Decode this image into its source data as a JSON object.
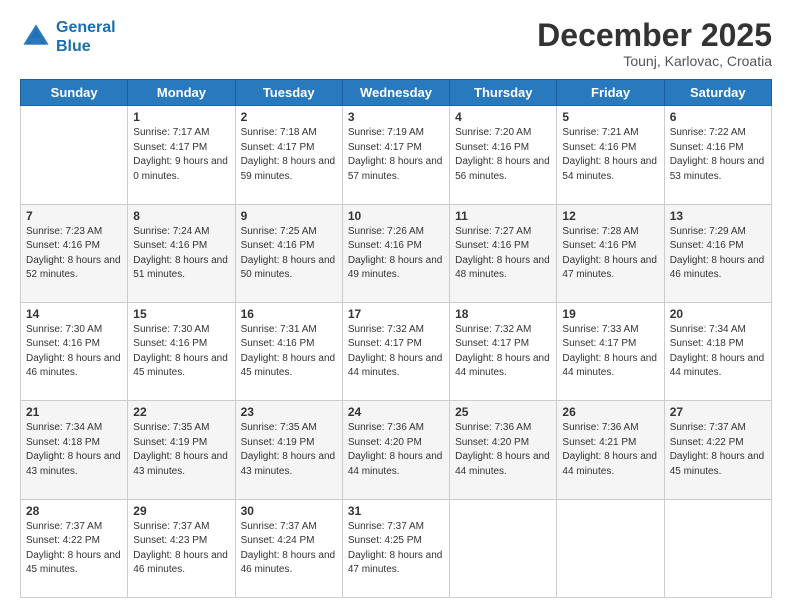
{
  "header": {
    "logo_line1": "General",
    "logo_line2": "Blue",
    "month": "December 2025",
    "location": "Tounj, Karlovac, Croatia"
  },
  "weekdays": [
    "Sunday",
    "Monday",
    "Tuesday",
    "Wednesday",
    "Thursday",
    "Friday",
    "Saturday"
  ],
  "weeks": [
    [
      {
        "day": "",
        "sunrise": "",
        "sunset": "",
        "daylight": ""
      },
      {
        "day": "1",
        "sunrise": "Sunrise: 7:17 AM",
        "sunset": "Sunset: 4:17 PM",
        "daylight": "Daylight: 9 hours and 0 minutes."
      },
      {
        "day": "2",
        "sunrise": "Sunrise: 7:18 AM",
        "sunset": "Sunset: 4:17 PM",
        "daylight": "Daylight: 8 hours and 59 minutes."
      },
      {
        "day": "3",
        "sunrise": "Sunrise: 7:19 AM",
        "sunset": "Sunset: 4:17 PM",
        "daylight": "Daylight: 8 hours and 57 minutes."
      },
      {
        "day": "4",
        "sunrise": "Sunrise: 7:20 AM",
        "sunset": "Sunset: 4:16 PM",
        "daylight": "Daylight: 8 hours and 56 minutes."
      },
      {
        "day": "5",
        "sunrise": "Sunrise: 7:21 AM",
        "sunset": "Sunset: 4:16 PM",
        "daylight": "Daylight: 8 hours and 54 minutes."
      },
      {
        "day": "6",
        "sunrise": "Sunrise: 7:22 AM",
        "sunset": "Sunset: 4:16 PM",
        "daylight": "Daylight: 8 hours and 53 minutes."
      }
    ],
    [
      {
        "day": "7",
        "sunrise": "Sunrise: 7:23 AM",
        "sunset": "Sunset: 4:16 PM",
        "daylight": "Daylight: 8 hours and 52 minutes."
      },
      {
        "day": "8",
        "sunrise": "Sunrise: 7:24 AM",
        "sunset": "Sunset: 4:16 PM",
        "daylight": "Daylight: 8 hours and 51 minutes."
      },
      {
        "day": "9",
        "sunrise": "Sunrise: 7:25 AM",
        "sunset": "Sunset: 4:16 PM",
        "daylight": "Daylight: 8 hours and 50 minutes."
      },
      {
        "day": "10",
        "sunrise": "Sunrise: 7:26 AM",
        "sunset": "Sunset: 4:16 PM",
        "daylight": "Daylight: 8 hours and 49 minutes."
      },
      {
        "day": "11",
        "sunrise": "Sunrise: 7:27 AM",
        "sunset": "Sunset: 4:16 PM",
        "daylight": "Daylight: 8 hours and 48 minutes."
      },
      {
        "day": "12",
        "sunrise": "Sunrise: 7:28 AM",
        "sunset": "Sunset: 4:16 PM",
        "daylight": "Daylight: 8 hours and 47 minutes."
      },
      {
        "day": "13",
        "sunrise": "Sunrise: 7:29 AM",
        "sunset": "Sunset: 4:16 PM",
        "daylight": "Daylight: 8 hours and 46 minutes."
      }
    ],
    [
      {
        "day": "14",
        "sunrise": "Sunrise: 7:30 AM",
        "sunset": "Sunset: 4:16 PM",
        "daylight": "Daylight: 8 hours and 46 minutes."
      },
      {
        "day": "15",
        "sunrise": "Sunrise: 7:30 AM",
        "sunset": "Sunset: 4:16 PM",
        "daylight": "Daylight: 8 hours and 45 minutes."
      },
      {
        "day": "16",
        "sunrise": "Sunrise: 7:31 AM",
        "sunset": "Sunset: 4:16 PM",
        "daylight": "Daylight: 8 hours and 45 minutes."
      },
      {
        "day": "17",
        "sunrise": "Sunrise: 7:32 AM",
        "sunset": "Sunset: 4:17 PM",
        "daylight": "Daylight: 8 hours and 44 minutes."
      },
      {
        "day": "18",
        "sunrise": "Sunrise: 7:32 AM",
        "sunset": "Sunset: 4:17 PM",
        "daylight": "Daylight: 8 hours and 44 minutes."
      },
      {
        "day": "19",
        "sunrise": "Sunrise: 7:33 AM",
        "sunset": "Sunset: 4:17 PM",
        "daylight": "Daylight: 8 hours and 44 minutes."
      },
      {
        "day": "20",
        "sunrise": "Sunrise: 7:34 AM",
        "sunset": "Sunset: 4:18 PM",
        "daylight": "Daylight: 8 hours and 44 minutes."
      }
    ],
    [
      {
        "day": "21",
        "sunrise": "Sunrise: 7:34 AM",
        "sunset": "Sunset: 4:18 PM",
        "daylight": "Daylight: 8 hours and 43 minutes."
      },
      {
        "day": "22",
        "sunrise": "Sunrise: 7:35 AM",
        "sunset": "Sunset: 4:19 PM",
        "daylight": "Daylight: 8 hours and 43 minutes."
      },
      {
        "day": "23",
        "sunrise": "Sunrise: 7:35 AM",
        "sunset": "Sunset: 4:19 PM",
        "daylight": "Daylight: 8 hours and 43 minutes."
      },
      {
        "day": "24",
        "sunrise": "Sunrise: 7:36 AM",
        "sunset": "Sunset: 4:20 PM",
        "daylight": "Daylight: 8 hours and 44 minutes."
      },
      {
        "day": "25",
        "sunrise": "Sunrise: 7:36 AM",
        "sunset": "Sunset: 4:20 PM",
        "daylight": "Daylight: 8 hours and 44 minutes."
      },
      {
        "day": "26",
        "sunrise": "Sunrise: 7:36 AM",
        "sunset": "Sunset: 4:21 PM",
        "daylight": "Daylight: 8 hours and 44 minutes."
      },
      {
        "day": "27",
        "sunrise": "Sunrise: 7:37 AM",
        "sunset": "Sunset: 4:22 PM",
        "daylight": "Daylight: 8 hours and 45 minutes."
      }
    ],
    [
      {
        "day": "28",
        "sunrise": "Sunrise: 7:37 AM",
        "sunset": "Sunset: 4:22 PM",
        "daylight": "Daylight: 8 hours and 45 minutes."
      },
      {
        "day": "29",
        "sunrise": "Sunrise: 7:37 AM",
        "sunset": "Sunset: 4:23 PM",
        "daylight": "Daylight: 8 hours and 46 minutes."
      },
      {
        "day": "30",
        "sunrise": "Sunrise: 7:37 AM",
        "sunset": "Sunset: 4:24 PM",
        "daylight": "Daylight: 8 hours and 46 minutes."
      },
      {
        "day": "31",
        "sunrise": "Sunrise: 7:37 AM",
        "sunset": "Sunset: 4:25 PM",
        "daylight": "Daylight: 8 hours and 47 minutes."
      },
      {
        "day": "",
        "sunrise": "",
        "sunset": "",
        "daylight": ""
      },
      {
        "day": "",
        "sunrise": "",
        "sunset": "",
        "daylight": ""
      },
      {
        "day": "",
        "sunrise": "",
        "sunset": "",
        "daylight": ""
      }
    ]
  ]
}
